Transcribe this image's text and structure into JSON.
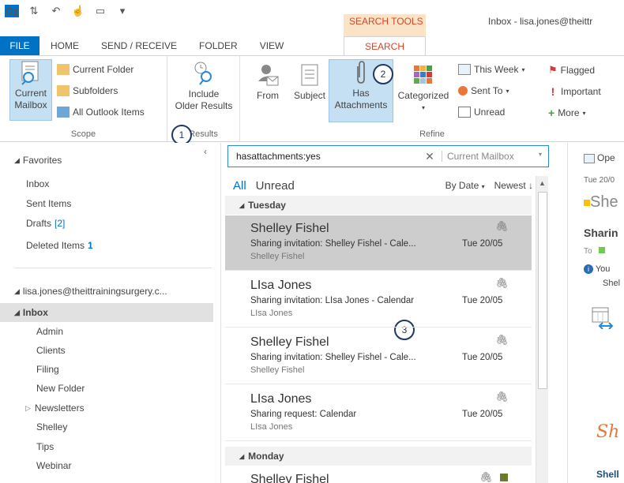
{
  "titlebar": {
    "context_group": "SEARCH TOOLS",
    "window_title": "Inbox - lisa.jones@theittr"
  },
  "tabs": [
    "FILE",
    "HOME",
    "SEND / RECEIVE",
    "FOLDER",
    "VIEW",
    "SEARCH"
  ],
  "ribbon": {
    "scope": {
      "label": "Scope",
      "current_mailbox": "Current Mailbox",
      "current_folder": "Current Folder",
      "subfolders": "Subfolders",
      "all_outlook_items": "All Outlook Items"
    },
    "results": {
      "label": "Results",
      "include_older_1": "Include",
      "include_older_2": "Older Results"
    },
    "refine": {
      "label": "Refine",
      "from": "From",
      "subject": "Subject",
      "has_attachments_1": "Has",
      "has_attachments_2": "Attachments",
      "categorized": "Categorized",
      "this_week": "This Week",
      "sent_to": "Sent To",
      "unread": "Unread",
      "flagged": "Flagged",
      "important": "Important",
      "more": "More"
    }
  },
  "callouts": [
    "1",
    "2",
    "3"
  ],
  "sidebar": {
    "favorites": "Favorites",
    "favorites_items": [
      {
        "label": "Inbox",
        "count": ""
      },
      {
        "label": "Sent Items",
        "count": ""
      },
      {
        "label": "Drafts",
        "count": "[2]"
      },
      {
        "label": "Deleted Items",
        "count": "1"
      }
    ],
    "account": "lisa.jones@theittrainingsurgery.c...",
    "inbox": "Inbox",
    "folders": [
      "Admin",
      "Clients",
      "Filing",
      "New Folder",
      "Newsletters",
      "Shelley",
      "Tips",
      "Webinar"
    ]
  },
  "search": {
    "query": "hasattachments:yes",
    "scope": "Current Mailbox"
  },
  "filters": {
    "all": "All",
    "unread": "Unread",
    "sort": "By Date",
    "order": "Newest"
  },
  "groups": {
    "tuesday": "Tuesday",
    "monday": "Monday"
  },
  "messages": [
    {
      "from": "Shelley Fishel",
      "subject": "Sharing invitation: Shelley Fishel - Cale...",
      "preview": "Shelley Fishel",
      "date": "Tue 20/05"
    },
    {
      "from": "LIsa Jones",
      "subject": "Sharing invitation: LIsa Jones - Calendar",
      "preview": "LIsa Jones",
      "date": "Tue 20/05"
    },
    {
      "from": "Shelley Fishel",
      "subject": "Sharing invitation: Shelley Fishel - Cale...",
      "preview": "Shelley Fishel",
      "date": "Tue 20/05"
    },
    {
      "from": "LIsa Jones",
      "subject": "Sharing request: Calendar",
      "preview": "LIsa Jones",
      "date": "Tue 20/05"
    },
    {
      "from": "Shelley Fishel",
      "subject": "",
      "preview": "",
      "date": ""
    }
  ],
  "reading_pane": {
    "open": "Ope",
    "date": "Tue 20/0",
    "sender": "She",
    "subject": "Sharin",
    "to": "To",
    "info1": "You",
    "info2": "Shel",
    "signature": "Sh",
    "footer": "Shell"
  }
}
